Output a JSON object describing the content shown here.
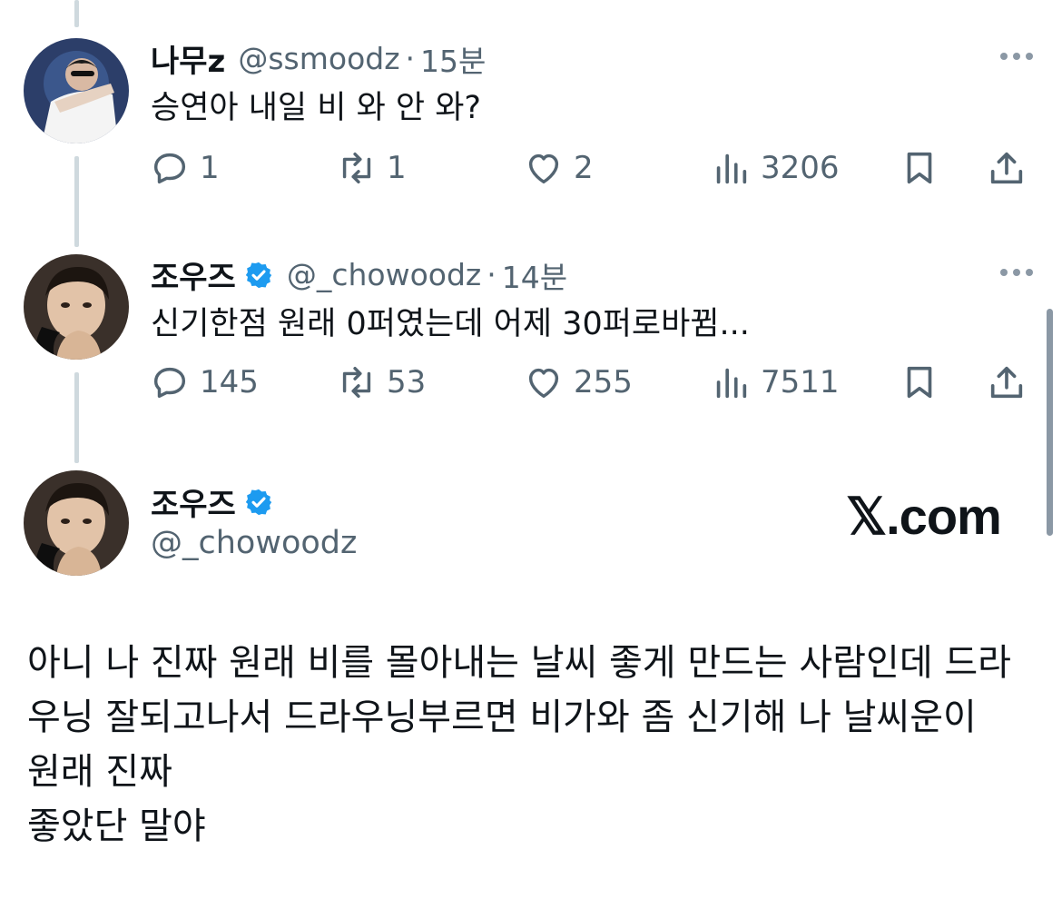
{
  "tweets": [
    {
      "display_name": "나무z",
      "handle": "@ssmoodz",
      "separator": "·",
      "time": "15분",
      "text": "승연아 내일 비 와 안 와?",
      "verified": false,
      "replies": "1",
      "retweets": "1",
      "likes": "2",
      "views": "3206"
    },
    {
      "display_name": "조우즈",
      "handle": "@_chowoodz",
      "separator": "·",
      "time": "14분",
      "text": "신기한점 원래 0퍼였는데 어제 30퍼로바뀜...",
      "verified": true,
      "replies": "145",
      "retweets": "53",
      "likes": "255",
      "views": "7511"
    }
  ],
  "main_tweet": {
    "display_name": "조우즈",
    "handle": "@_chowoodz",
    "verified": true,
    "text_lines": [
      "아니 나 진짜 원래 비를 몰아내는 날씨 좋게 만드는 사람인데 드라",
      "우닝 잘되고나서 드라우닝부르면 비가와 좀 신기해 나 날씨운이",
      "원래 진짜",
      "좋았단 말야"
    ]
  },
  "watermark": "𝕏.com",
  "colors": {
    "text": "#0f1419",
    "secondary": "#536471",
    "verified": "#1d9bf0",
    "thread_line": "#cfd9de"
  },
  "icons": {
    "reply": "speech-bubble-icon",
    "retweet": "retweet-icon",
    "like": "heart-icon",
    "views": "bar-chart-icon",
    "bookmark": "bookmark-icon",
    "share": "share-icon",
    "more": "more-dots-icon",
    "verified": "verified-badge-icon"
  }
}
